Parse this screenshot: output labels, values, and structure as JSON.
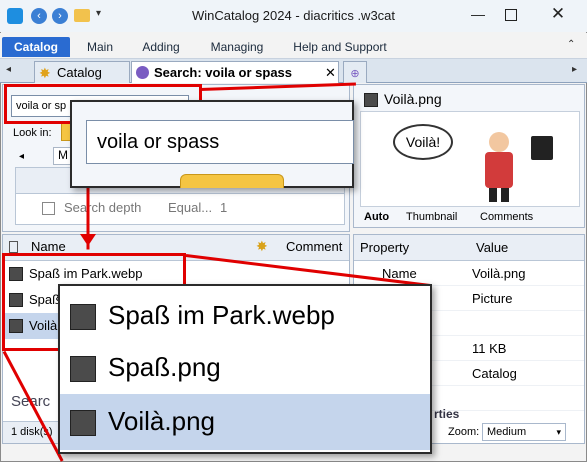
{
  "window": {
    "title": "WinCatalog 2024 - diacritics .w3cat"
  },
  "menu": {
    "items": [
      "Catalog",
      "Main",
      "Adding",
      "Managing",
      "Help and Support"
    ]
  },
  "tabs": {
    "catalog": "Catalog",
    "search": "Search: voila or spass"
  },
  "search": {
    "query_small": "voila or sp",
    "query_zoom": "voila or spass",
    "look_in_label": "Look in:",
    "criteria_row": {
      "label": "Search depth",
      "op": "Equal...",
      "value": "1"
    }
  },
  "file_list": {
    "col_name": "Name",
    "col_comment": "Comment",
    "rows": [
      "Spaß im Park.webp",
      "Spaß.png",
      "Voilà.png"
    ],
    "search_label": "Searc",
    "status": "1 disk(s)"
  },
  "zoom_list": {
    "rows": [
      "Spaß im Park.webp",
      "Spaß.png",
      "Voilà.png"
    ]
  },
  "preview": {
    "filename": "Voilà.png",
    "image_text": "Voilà!",
    "tabs": [
      "Auto",
      "Thumbnail",
      "Comments"
    ]
  },
  "properties": {
    "col_property": "Property",
    "col_value": "Value",
    "rows": [
      {
        "property": "Name",
        "value": "Voilà.png"
      },
      {
        "property": "",
        "value": "Picture"
      },
      {
        "property": "o...",
        "value": ""
      },
      {
        "property": "",
        "value": "11 KB"
      },
      {
        "property": "in...",
        "value": "Catalog"
      },
      {
        "property": "ts",
        "value": ""
      }
    ],
    "section_partial": "rties"
  },
  "zoom_control": {
    "label": "Zoom:",
    "value": "Medium"
  },
  "colors": {
    "accent": "#2a6bd1",
    "highlight": "#e00000",
    "selection": "#c5d5ec"
  }
}
